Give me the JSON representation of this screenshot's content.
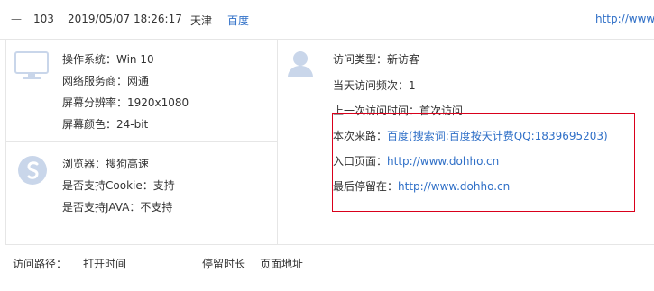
{
  "header": {
    "toggle_symbol": "—",
    "id": "103",
    "datetime": "2019/05/07 18:26:17",
    "city": "天津",
    "source": "百度",
    "url_fragment": "http://www.c"
  },
  "left_panel": {
    "os_section": {
      "icon": "monitor-icon",
      "os": "操作系统：Win 10",
      "isp": "网络服务商：网通",
      "resolution": "屏幕分辨率：1920x1080",
      "color_depth": "屏幕颜色：24-bit"
    },
    "browser_section": {
      "icon": "sogou-browser-icon",
      "browser": "浏览器：搜狗高速",
      "cookie": "是否支持Cookie：支持",
      "java": "是否支持JAVA：不支持"
    }
  },
  "right_panel": {
    "icon": "user-icon",
    "visit_type": "访问类型：新访客",
    "visits_today": "当天访问频次：1",
    "last_visit": "上一次访问时间：首次访问",
    "source_label": "本次来路：",
    "source_value": "百度(搜索词:百度按天计费QQ:1839695203)",
    "entry_label": "入口页面：",
    "entry_value": "http://www.dohho.cn",
    "last_page_label": "最后停留在：",
    "last_page_value": "http://www.dohho.cn"
  },
  "path_table": {
    "label": "访问路径：",
    "columns": [
      "打开时间",
      "停留时长",
      "页面地址"
    ]
  },
  "colors": {
    "link": "#2f6fc7",
    "highlight_border": "#d9001b",
    "icon_fill": "#c9d6ea"
  }
}
